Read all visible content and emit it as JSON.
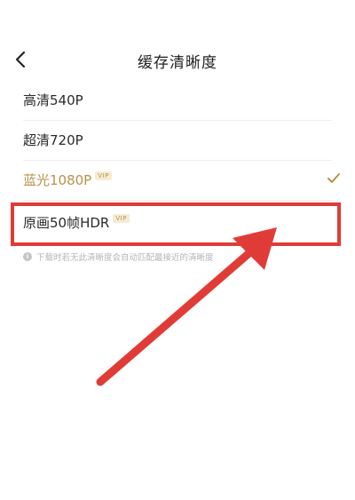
{
  "header": {
    "title": "缓存清晰度",
    "back_icon": "chevron-left-icon"
  },
  "options": [
    {
      "label": "高清540P",
      "vip": "",
      "selected": false
    },
    {
      "label": "超清720P",
      "vip": "",
      "selected": false
    },
    {
      "label": "蓝光1080P",
      "vip": "VIP",
      "selected": true
    },
    {
      "label": "原画50帧HDR",
      "vip": "VIP",
      "selected": false
    }
  ],
  "hint": {
    "text": "下载时若无此清晰度会自动匹配最接近的清晰度",
    "icon": "info-icon"
  },
  "colors": {
    "accent_gold": "#b8924a",
    "annotation_red": "#e03c37"
  }
}
